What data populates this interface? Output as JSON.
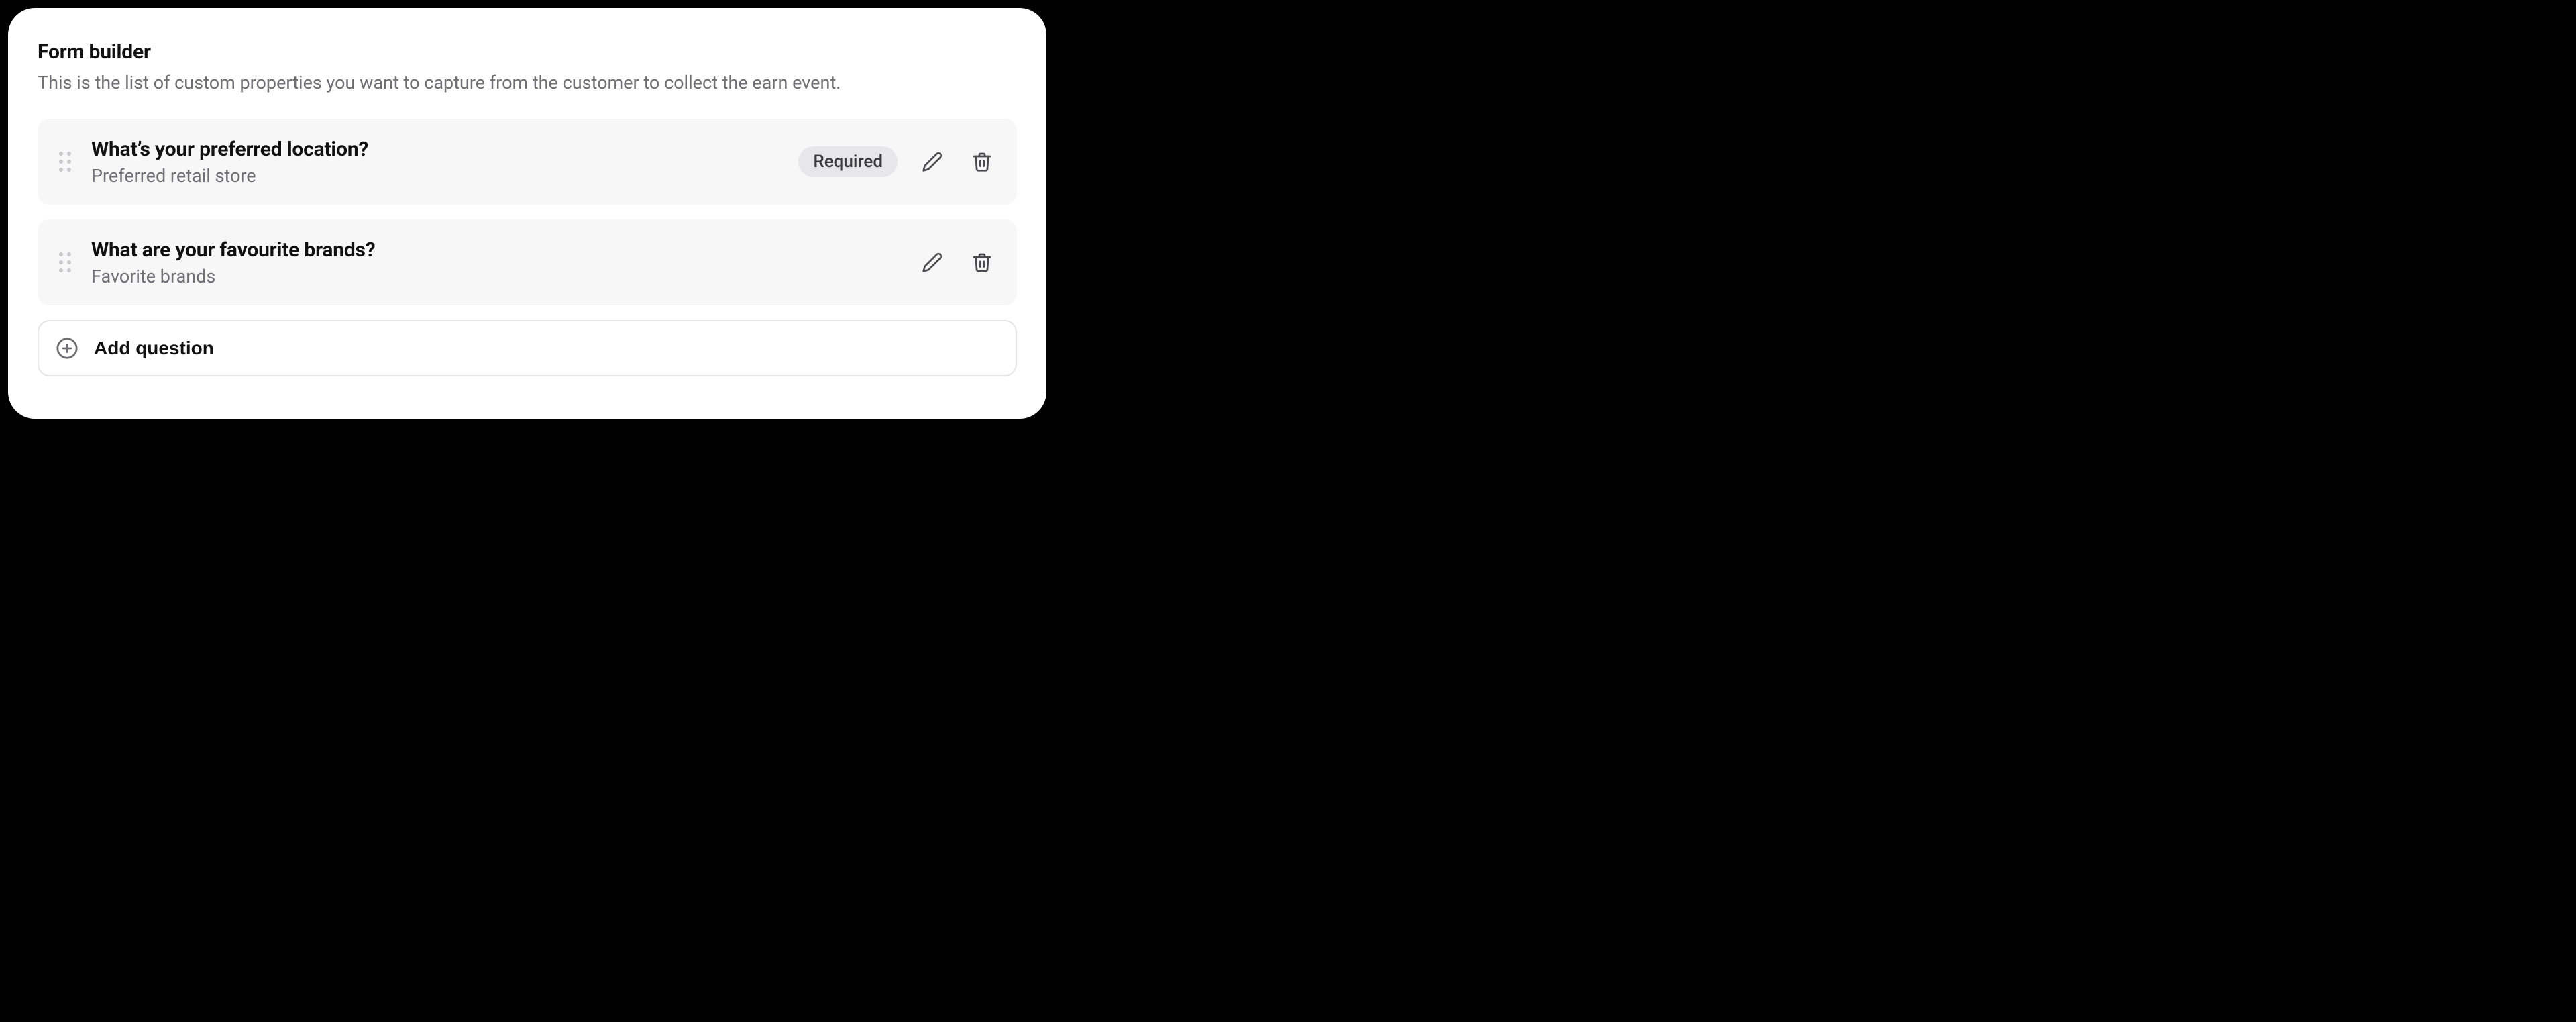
{
  "header": {
    "title": "Form builder",
    "description": "This is the list of custom properties you want to capture from the customer to collect the earn event."
  },
  "questions": [
    {
      "title": "What’s your preferred location?",
      "subtitle": "Preferred retail store",
      "required_label": "Required",
      "required": true
    },
    {
      "title": "What are your favourite brands?",
      "subtitle": "Favorite brands",
      "required": false
    }
  ],
  "add_button": {
    "label": "Add question"
  }
}
